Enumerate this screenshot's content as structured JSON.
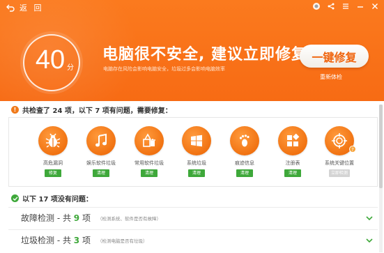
{
  "header": {
    "back_label": "返 回",
    "score": "40",
    "score_unit": "分",
    "headline": "电脑很不安全, 建议立即修复",
    "subline": "电脑存在风险会影响电脑安全，垃圾过多会影响电脑效率",
    "fix_button": "一键修复",
    "recheck_label": "重新体检",
    "accent_color": "#f76b14"
  },
  "window_controls": [
    "skin-icon",
    "share-icon",
    "menu-icon",
    "minimize-icon",
    "close-icon"
  ],
  "issues_section": {
    "title": "共检查了 24 项，以下 7 项有问题，需要修复：",
    "items": [
      {
        "label": "高危漏洞",
        "action": "修复",
        "icon": "bug-icon"
      },
      {
        "label": "娱乐软件垃圾",
        "action": "清理",
        "icon": "music-note-icon"
      },
      {
        "label": "常用软件垃圾",
        "action": "清理",
        "icon": "software-trash-icon"
      },
      {
        "label": "系统垃圾",
        "action": "清理",
        "icon": "windows-logo-icon"
      },
      {
        "label": "痕迹信息",
        "action": "清理",
        "icon": "footprint-icon"
      },
      {
        "label": "注册表",
        "action": "清理",
        "icon": "registry-icon"
      },
      {
        "label": "系统关键位置",
        "action": "立即检测",
        "icon": "target-icon",
        "disabled": true
      }
    ]
  },
  "passed_section": {
    "title": "以下 17 项没有问题：",
    "rows": [
      {
        "name": "故障检测",
        "sep": " - 共 ",
        "count": "9",
        "unit": " 项",
        "note": "（检测系统、软件是否有故障）"
      },
      {
        "name": "垃圾检测",
        "sep": " - 共 ",
        "count": "3",
        "unit": " 项",
        "note": "（检测电脑是否有垃圾）"
      }
    ]
  },
  "status_colors": {
    "ok": "#3ea83a",
    "warn": "#f07a1a"
  }
}
